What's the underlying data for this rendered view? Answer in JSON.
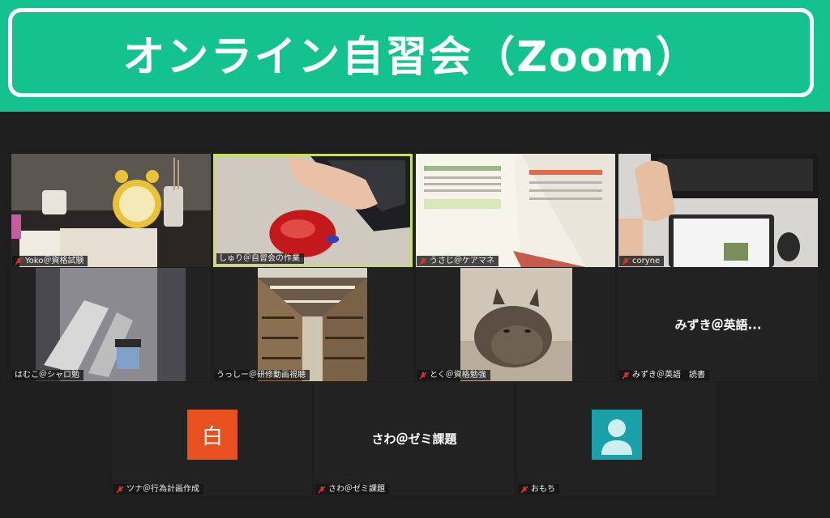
{
  "banner": {
    "title": "オンライン自習会（Zoom）"
  },
  "participants": [
    {
      "name": "Yoko＠資格試験",
      "muted": true
    },
    {
      "name": "しゅり＠自習会の作業",
      "muted": false,
      "active": true
    },
    {
      "name": "うさじ＠ケアマネ",
      "muted": true
    },
    {
      "name": "coryne",
      "muted": true
    },
    {
      "name": "はむこ＠シャロ勉",
      "muted": false
    },
    {
      "name": "うっしー＠研修動画視聴",
      "muted": false
    },
    {
      "name": "とく＠資格勉強",
      "muted": true
    },
    {
      "name": "みずき＠英語　読書",
      "display": "みずき＠英語...",
      "muted": true
    },
    {
      "name": "ツナ＠行為計画作成",
      "initial": "白",
      "avatar_color": "#e8501f",
      "muted": true
    },
    {
      "name": "さわ＠ゼミ課題",
      "display": "さわ＠ゼミ課題",
      "muted": true
    },
    {
      "name": "おもち",
      "avatar_color": "#1aa0a8",
      "muted": true
    }
  ],
  "colors": {
    "banner": "#13c28e",
    "active_border": "#c7df5a",
    "mute": "#e0352b"
  }
}
